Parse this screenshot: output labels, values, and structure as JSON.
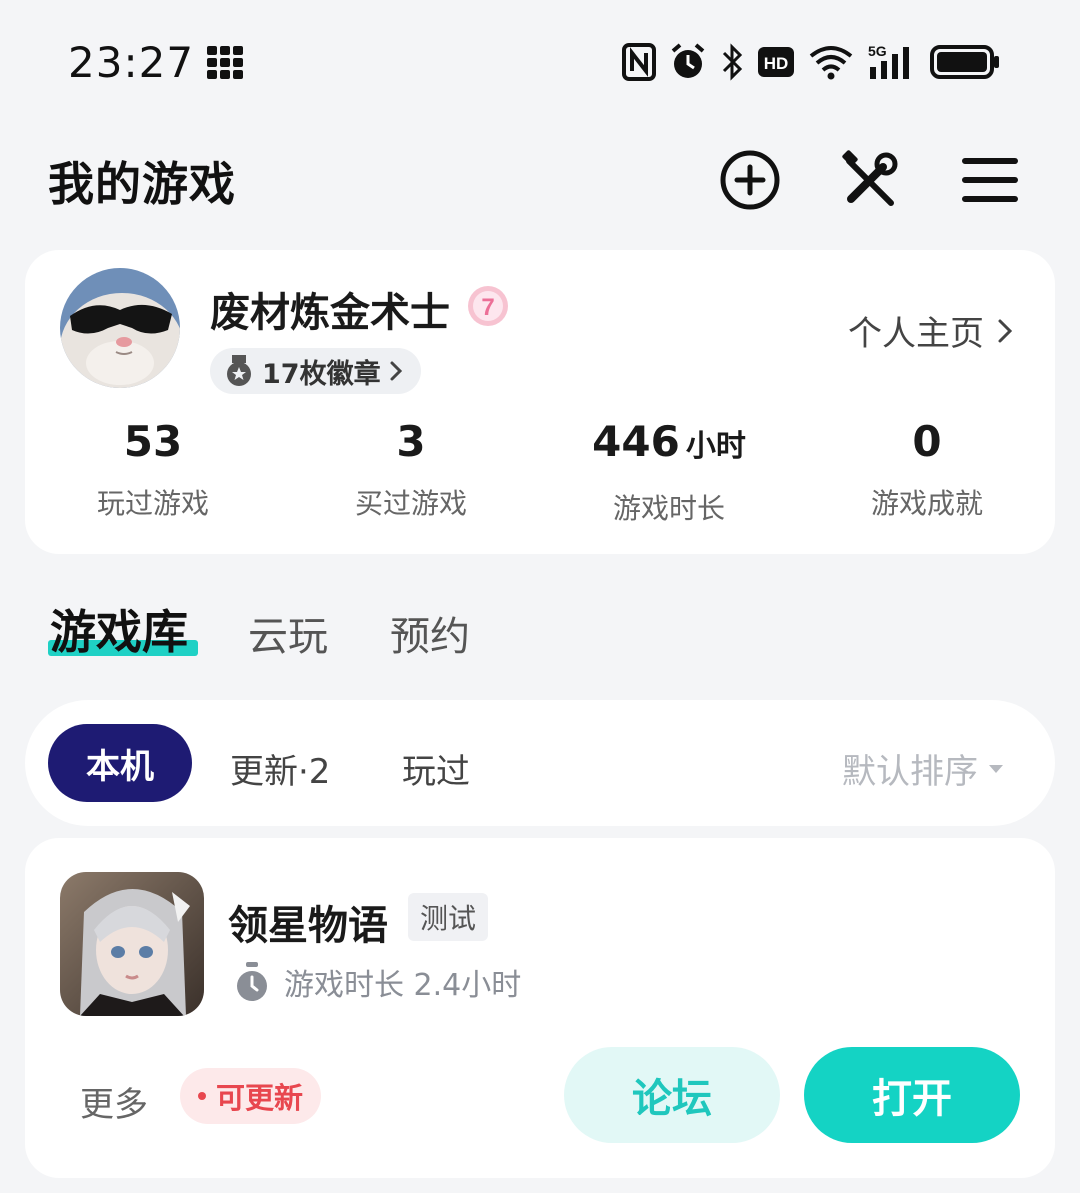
{
  "status_bar": {
    "time": "23:27",
    "icons": [
      "apps-grid-icon",
      "nfc-icon",
      "alarm-icon",
      "bluetooth-icon",
      "hd-icon",
      "wifi-icon",
      "signal-5g-icon",
      "battery-icon"
    ],
    "hd_label": "HD",
    "network_label": "5G"
  },
  "header": {
    "title": "我的游戏",
    "icons": [
      "add-circle-icon",
      "tools-icon",
      "menu-icon"
    ]
  },
  "profile": {
    "username": "废材炼金术士",
    "level_badge": "7",
    "badges_label": "17枚徽章",
    "homepage_link": "个人主页",
    "stats": [
      {
        "value": "53",
        "unit": "",
        "label": "玩过游戏"
      },
      {
        "value": "3",
        "unit": "",
        "label": "买过游戏"
      },
      {
        "value": "446",
        "unit": "小时",
        "label": "游戏时长"
      },
      {
        "value": "0",
        "unit": "",
        "label": "游戏成就"
      }
    ]
  },
  "tabs": {
    "active": "游戏库",
    "items": [
      "游戏库",
      "云玩",
      "预约"
    ]
  },
  "filters": {
    "chips": [
      "本机",
      "更新·2",
      "玩过"
    ],
    "active_chip": "本机",
    "sort_label": "默认排序"
  },
  "game": {
    "name": "领星物语",
    "tag": "测试",
    "playtime": "游戏时长 2.4小时",
    "more_label": "更多",
    "update_label": "可更新",
    "forum_button": "论坛",
    "open_button": "打开"
  },
  "colors": {
    "accent_teal": "#14d3c4",
    "chip_active_bg": "#1e1b73",
    "update_red": "#e8474f",
    "page_bg": "#f4f5f7"
  }
}
